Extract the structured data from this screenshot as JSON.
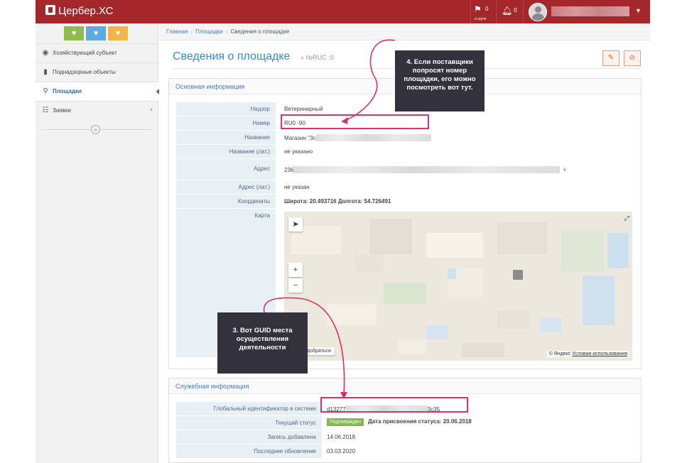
{
  "app": {
    "title": "Цербер.ХС"
  },
  "topbar": {
    "flag_count": "0",
    "flag_sub": "в групп",
    "bell_count": "0"
  },
  "sidebar": {
    "items": [
      {
        "label": "Хозяйствующий субъект",
        "icon": "person-circle-icon"
      },
      {
        "label": "Поднадзорные объекты",
        "icon": "building-icon"
      },
      {
        "label": "Площадки",
        "icon": "map-pin-icon",
        "active": true
      },
      {
        "label": "Заявки",
        "icon": "sitemap-icon"
      }
    ],
    "collapse_symbol": "«"
  },
  "breadcrumb": {
    "home": "Главная",
    "section": "Площадки",
    "current": "Сведения о площадке"
  },
  "page": {
    "title": "Сведения о площадке",
    "subtitle": "» №RUС  :9"
  },
  "main_info": {
    "heading": "Основная информация",
    "fields": [
      {
        "label": "Надзор",
        "value": "Ветеринарный"
      },
      {
        "label": "Номер",
        "value": "RU0   -90"
      },
      {
        "label": "Название",
        "value": "Магазин \"Зс"
      },
      {
        "label": "Название (лат.)",
        "value": "не указано"
      },
      {
        "label": "Адрес",
        "value": "236"
      },
      {
        "label": "Адрес (лат.)",
        "value": "не указан"
      },
      {
        "label": "Координаты",
        "value": "Широта: 20.493716 Долгота: 54.726491"
      },
      {
        "label": "Карта",
        "value": ""
      }
    ]
  },
  "map": {
    "route_label": "к добраться",
    "copyright": "© Яндекс",
    "terms": "Условия использования",
    "zoom_in": "+",
    "zoom_out": "−",
    "locate": "➤"
  },
  "service_info": {
    "heading": "Служебная информация",
    "fields": [
      {
        "label": "Глобальный идентификатор в системе",
        "value": "d13277",
        "value_end": "3c35"
      },
      {
        "label": "Текущий статус",
        "status": "Подтвержден",
        "value": "Дата присвоения статуса: 20.06.2018"
      },
      {
        "label": "Запись добавлена",
        "value": "14.06.2018"
      },
      {
        "label": "Последнее обновление",
        "value": "03.03.2020"
      }
    ]
  },
  "annotations": {
    "callout_4": "4. Если поставщики попросят номер площадки, его можно посмотреть вот тут.",
    "callout_3": "3. Вот GUID места осуществления деятельности",
    "color": "#d8326b"
  }
}
